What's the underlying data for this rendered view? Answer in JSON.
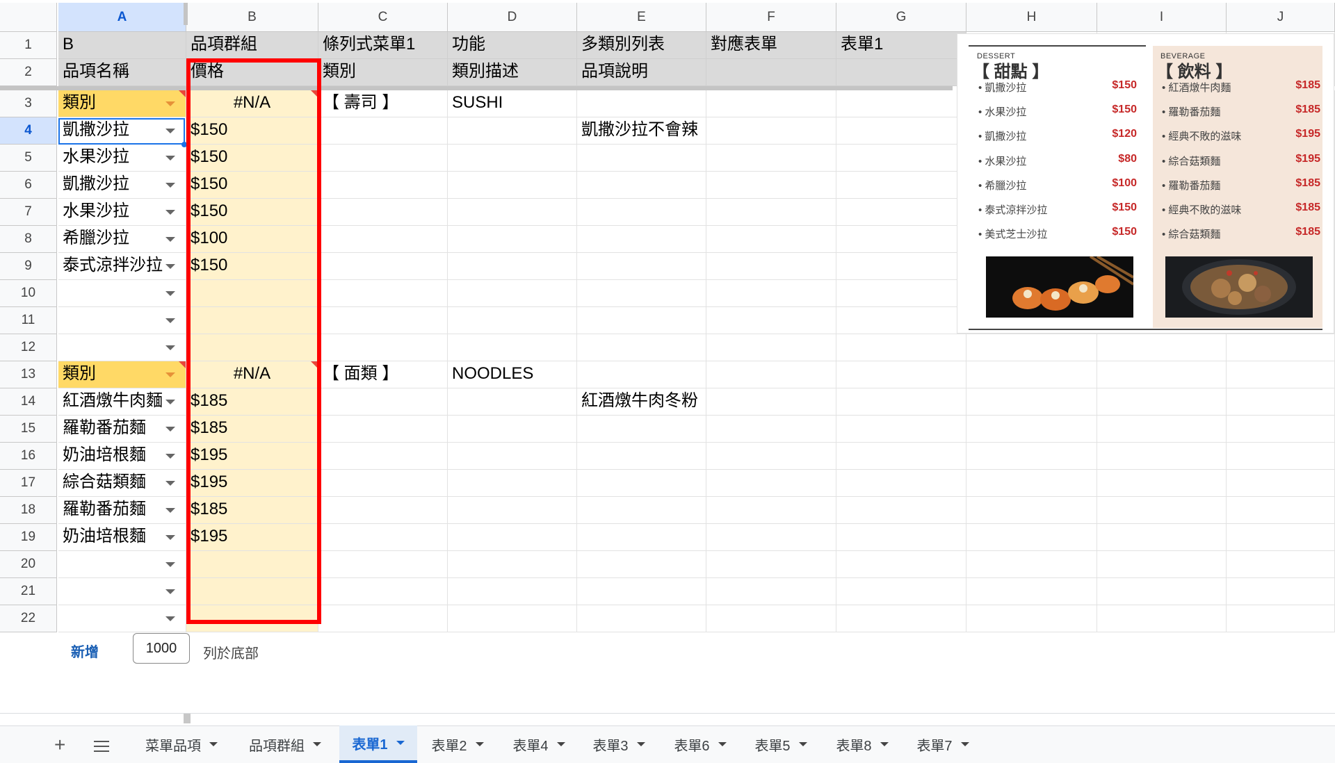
{
  "columns": [
    "A",
    "B",
    "C",
    "D",
    "E",
    "F",
    "G",
    "H",
    "I",
    "J"
  ],
  "rows": [
    "1",
    "2",
    "3",
    "4",
    "5",
    "6",
    "7",
    "8",
    "9",
    "10",
    "11",
    "12",
    "13",
    "14",
    "15",
    "16",
    "17",
    "18",
    "19",
    "20",
    "21",
    "22"
  ],
  "row1": {
    "a": "B",
    "b": "品項群組",
    "c": "條列式菜單1",
    "d": "功能",
    "e": "多類別列表",
    "f": "對應表單",
    "g": "表單1"
  },
  "row2": {
    "a": "品項名稱",
    "b": "價格",
    "c": "類別",
    "d": "類別描述",
    "e": "品項說明"
  },
  "section1": {
    "label": "類別",
    "na": "#N/A",
    "name": "【 壽司 】",
    "en": "SUSHI",
    "items": [
      {
        "name": "凱撒沙拉",
        "price": "$150",
        "note": "凱撒沙拉不會辣"
      },
      {
        "name": "水果沙拉",
        "price": "$150",
        "note": ""
      },
      {
        "name": "凱撒沙拉",
        "price": "$150",
        "note": ""
      },
      {
        "name": "水果沙拉",
        "price": "$150",
        "note": ""
      },
      {
        "name": "希臘沙拉",
        "price": "$100",
        "note": ""
      },
      {
        "name": "泰式涼拌沙拉",
        "price": "$150",
        "note": ""
      }
    ]
  },
  "section2": {
    "label": "類別",
    "na": "#N/A",
    "name": "【 面類 】",
    "en": "NOODLES",
    "items": [
      {
        "name": "紅酒燉牛肉麵",
        "price": "$185",
        "note": "紅酒燉牛肉冬粉"
      },
      {
        "name": "羅勒番茄麵",
        "price": "$185",
        "note": ""
      },
      {
        "name": "奶油培根麵",
        "price": "$195",
        "note": ""
      },
      {
        "name": "綜合菇類麵",
        "price": "$195",
        "note": ""
      },
      {
        "name": "羅勒番茄麵",
        "price": "$185",
        "note": ""
      },
      {
        "name": "奶油培根麵",
        "price": "$195",
        "note": ""
      }
    ]
  },
  "menu_image": {
    "left": {
      "tag": "DESSERT",
      "title": "【 甜點 】",
      "items": [
        {
          "name": "凱撒沙拉",
          "price": "$150"
        },
        {
          "name": "水果沙拉",
          "price": "$150"
        },
        {
          "name": "凱撒沙拉",
          "price": "$120"
        },
        {
          "name": "水果沙拉",
          "price": "$80"
        },
        {
          "name": "希臘沙拉",
          "price": "$100"
        },
        {
          "name": "泰式涼拌沙拉",
          "price": "$150"
        },
        {
          "name": "美式芝士沙拉",
          "price": "$150"
        }
      ]
    },
    "right": {
      "tag": "BEVERAGE",
      "title": "【 飲料 】",
      "items": [
        {
          "name": "紅酒燉牛肉麵",
          "price": "$185"
        },
        {
          "name": "羅勒番茄麵",
          "price": "$185"
        },
        {
          "name": "經典不敗的滋味",
          "price": "$195"
        },
        {
          "name": "綜合菇類麵",
          "price": "$195"
        },
        {
          "name": "羅勒番茄麵",
          "price": "$185"
        },
        {
          "name": "經典不敗的滋味",
          "price": "$185"
        },
        {
          "name": "綜合菇類麵",
          "price": "$185"
        }
      ]
    }
  },
  "footer": {
    "add": "新增",
    "rows": "1000",
    "suffix": "列於底部"
  },
  "tabs": [
    "菜單品項",
    "品項群組",
    "表單1",
    "表單2",
    "表單4",
    "表單3",
    "表單6",
    "表單5",
    "表單8",
    "表單7"
  ],
  "active_tab": "表單1",
  "colors": {
    "selection": "#1a73e8",
    "highlight_box": "#ff0000",
    "yellow": "#fff2cc",
    "gold": "#ffd966",
    "header_gray": "#dadada"
  }
}
